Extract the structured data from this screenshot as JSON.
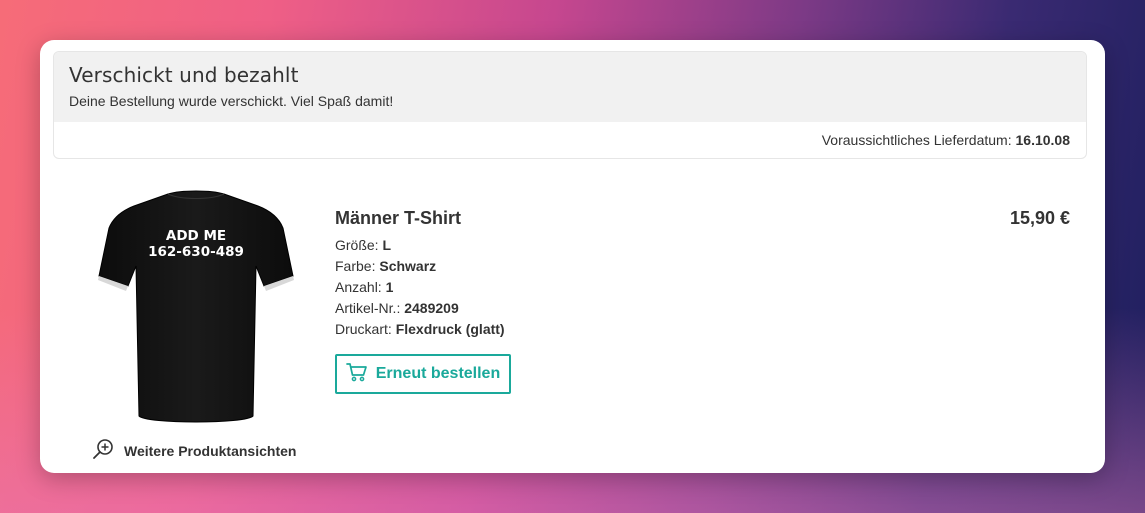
{
  "status": {
    "title": "Verschickt und bezahlt",
    "subtitle": "Deine Bestellung wurde verschickt. Viel Spaß damit!",
    "delivery_label": "Voraussichtliches Lieferdatum:",
    "delivery_date": "16.10.08"
  },
  "product": {
    "name": "Männer T-Shirt",
    "price": "15,90 €",
    "image_text_line1": "ADD ME",
    "image_text_line2": "162-630-489",
    "attributes": [
      {
        "label": "Größe:",
        "value": "L"
      },
      {
        "label": "Farbe:",
        "value": "Schwarz"
      },
      {
        "label": "Anzahl:",
        "value": "1"
      },
      {
        "label": "Artikel-Nr.:",
        "value": "2489209"
      },
      {
        "label": "Druckart:",
        "value": "Flexdruck (glatt)"
      }
    ],
    "more_views_label": "Weitere Produktansichten",
    "reorder_label": "Erneut bestellen"
  },
  "colors": {
    "accent": "#1aa99b",
    "text": "#333333",
    "status_bg": "#f1f1f1"
  },
  "icons": {
    "zoom": "zoom-in-icon",
    "cart": "cart-icon"
  }
}
